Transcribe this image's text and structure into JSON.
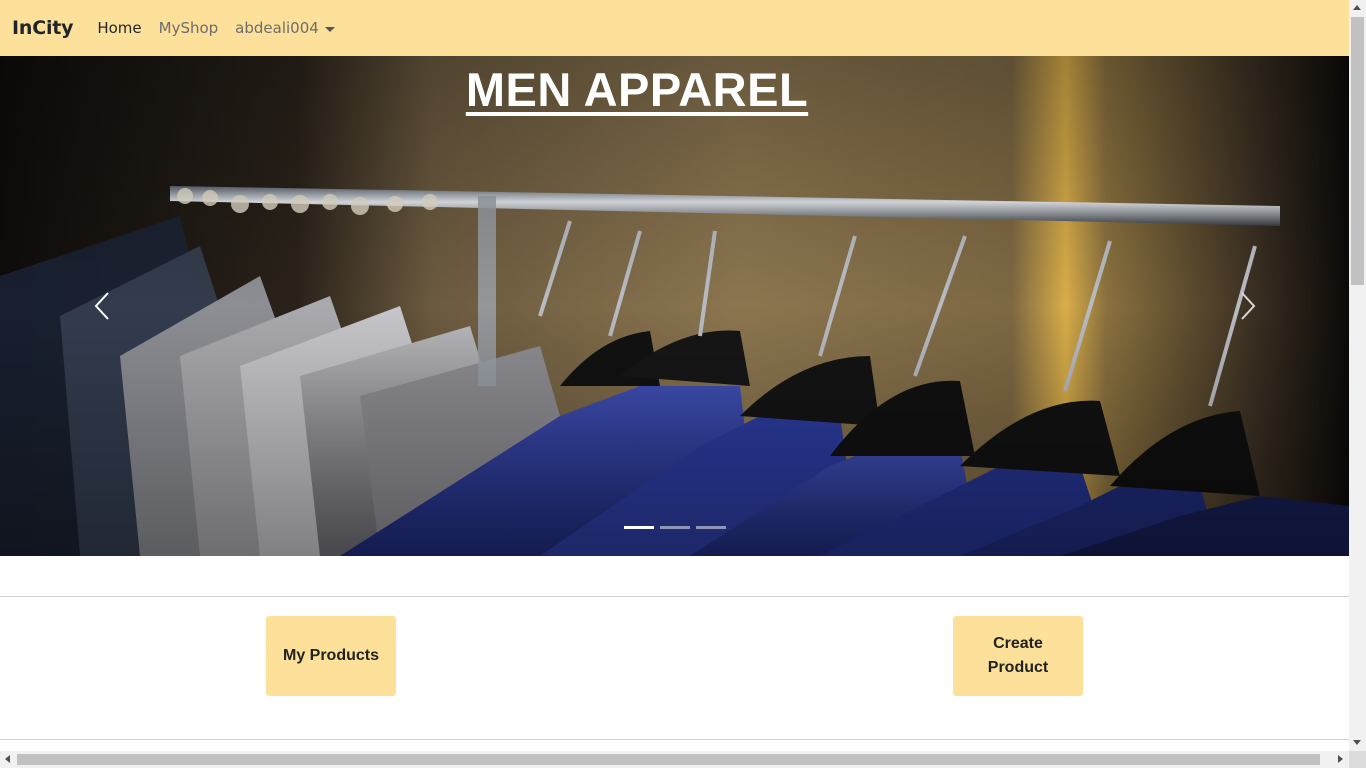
{
  "navbar": {
    "brand": "InCity",
    "links": [
      {
        "label": "Home"
      },
      {
        "label": "MyShop"
      }
    ],
    "user_menu_label": "abdeali004",
    "background": "#fde19a"
  },
  "carousel": {
    "caption": "MEN APPAREL",
    "prev_icon": "chevron-left-icon",
    "next_icon": "chevron-right-icon",
    "slide_count": 3,
    "active_slide": 1,
    "image_description_icon": "suit-rack-photo"
  },
  "actions": {
    "my_products_label": "My Products",
    "create_product_label": "Create Product",
    "button_color": "#fde19a"
  }
}
